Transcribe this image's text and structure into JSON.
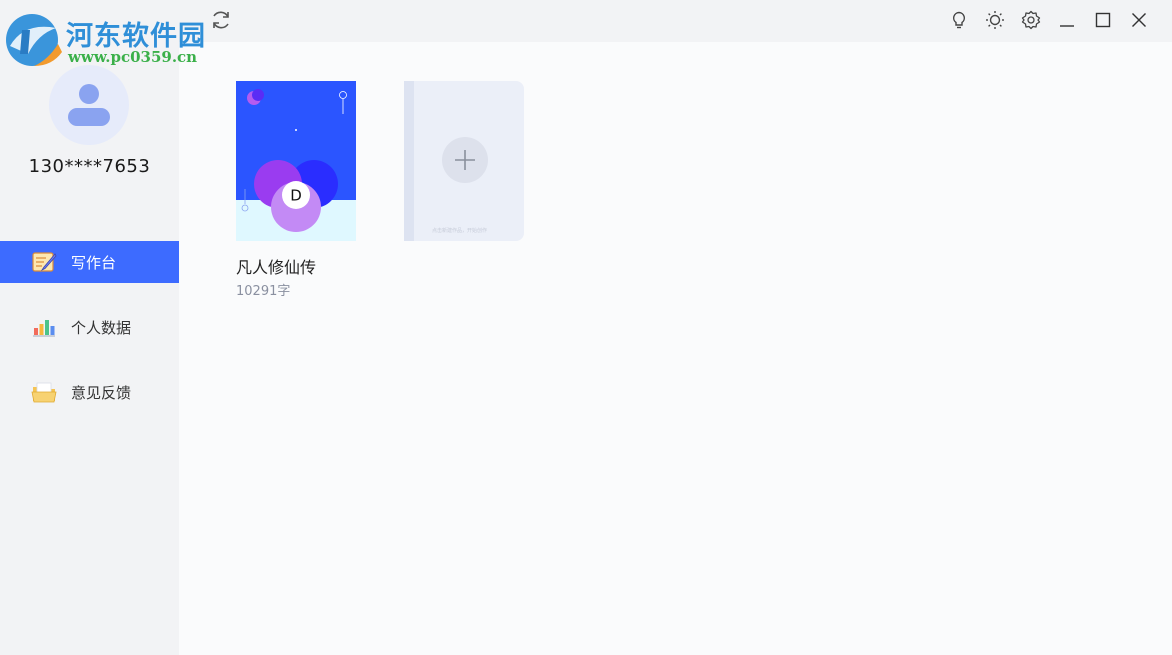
{
  "watermark": {
    "title": "河东软件园",
    "url": "www.pc0359.cn"
  },
  "user": {
    "phone": "130****7653"
  },
  "sidebar": {
    "items": [
      {
        "label": "写作台",
        "icon": "writing-desk-icon",
        "active": true
      },
      {
        "label": "个人数据",
        "icon": "bar-chart-icon",
        "active": false
      },
      {
        "label": "意见反馈",
        "icon": "folder-feedback-icon",
        "active": false
      }
    ]
  },
  "books": [
    {
      "title": "凡人修仙传",
      "word_count": "10291字",
      "cover_letter": "D"
    }
  ],
  "new_book": {
    "hint": "点击新建作品，开始创作"
  },
  "colors": {
    "accent": "#3d6bff",
    "sidebar_bg": "#f2f3f5",
    "main_bg": "#fafbfc",
    "cover_blue": "#2b55ff",
    "watermark_blue": "#2f8fd8",
    "watermark_green": "#3bb04a"
  }
}
